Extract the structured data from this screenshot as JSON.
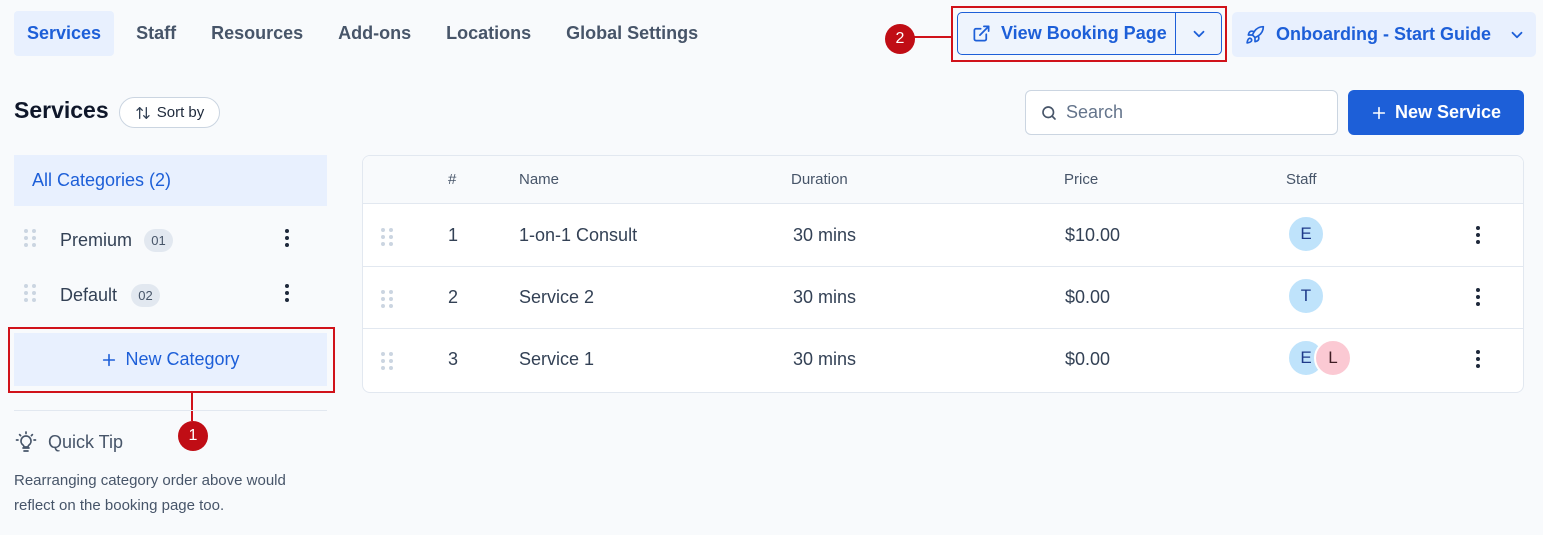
{
  "nav": {
    "tabs": [
      {
        "label": "Services",
        "active": true
      },
      {
        "label": "Staff",
        "active": false
      },
      {
        "label": "Resources",
        "active": false
      },
      {
        "label": "Add-ons",
        "active": false
      },
      {
        "label": "Locations",
        "active": false
      },
      {
        "label": "Global Settings",
        "active": false
      }
    ],
    "view_booking_label": "View Booking Page",
    "onboarding_label": "Onboarding - Start Guide"
  },
  "annotations": {
    "marker_1": "1",
    "marker_2": "2"
  },
  "services_panel": {
    "title": "Services",
    "sort_label": "Sort by",
    "all_categories_label": "All Categories (2)",
    "categories": [
      {
        "label": "Premium",
        "count": "01"
      },
      {
        "label": "Default",
        "count": "02"
      }
    ],
    "new_category_label": "New Category",
    "quick_tip_title": "Quick Tip",
    "quick_tip_text": "Rearranging category order above would reflect on the booking page too."
  },
  "search": {
    "placeholder": "Search"
  },
  "new_service_label": "New Service",
  "table": {
    "headers": {
      "num": "#",
      "name": "Name",
      "duration": "Duration",
      "price": "Price",
      "staff": "Staff"
    },
    "rows": [
      {
        "num": "1",
        "name": "1-on-1 Consult",
        "duration": "30 mins",
        "price": "$10.00",
        "staff": [
          "E"
        ]
      },
      {
        "num": "2",
        "name": "Service 2",
        "duration": "30 mins",
        "price": "$0.00",
        "staff": [
          "T"
        ]
      },
      {
        "num": "3",
        "name": "Service 1",
        "duration": "30 mins",
        "price": "$0.00",
        "staff": [
          "E",
          "L"
        ]
      }
    ]
  },
  "colors": {
    "accent": "#1d5fd8",
    "accent_light": "#e8f0fe",
    "annotation_red": "#d0121a"
  },
  "icons": [
    "external-link-icon",
    "chevron-down-icon",
    "rocket-icon",
    "sort-icon",
    "drag-handle-icon",
    "kebab-menu-icon",
    "plus-icon",
    "lightbulb-icon",
    "search-icon"
  ]
}
